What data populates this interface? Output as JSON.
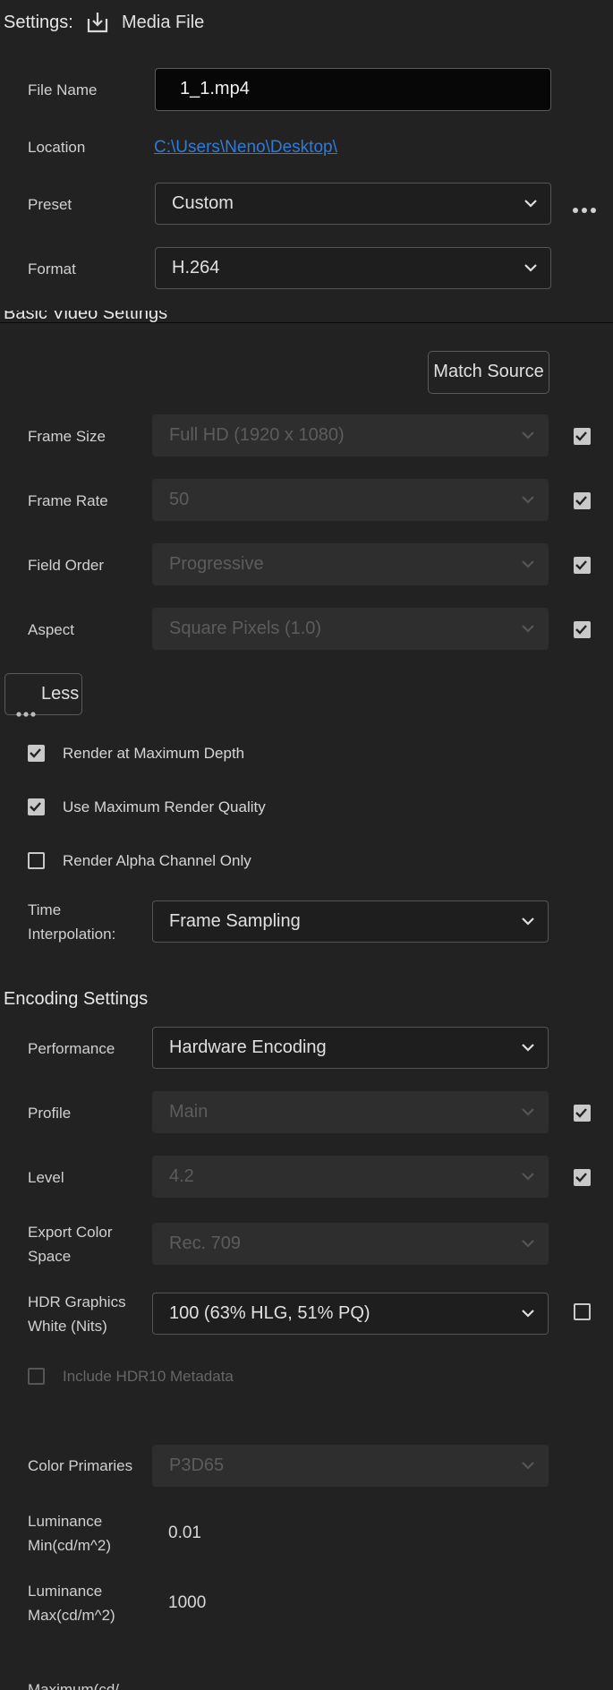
{
  "header": {
    "settings_label": "Settings:",
    "media_label": "Media File",
    "icon": "download-tray-icon"
  },
  "file": {
    "file_name_label": "File Name",
    "file_name_value": "1_1.mp4",
    "location_label": "Location",
    "location_value": "C:\\Users\\Neno\\Desktop\\",
    "preset_label": "Preset",
    "preset_value": "Custom",
    "more_icon": "more-dots-icon",
    "format_label": "Format",
    "format_value": "H.264"
  },
  "basic_video": {
    "section_title": "Basic Video Settings",
    "match_source_label": "Match Source",
    "frame_size_label": "Frame Size",
    "frame_size_value": "Full HD (1920 x 1080)",
    "frame_size_checked": true,
    "frame_rate_label": "Frame Rate",
    "frame_rate_value": "50",
    "frame_rate_checked": true,
    "field_order_label": "Field Order",
    "field_order_value": "Progressive",
    "field_order_checked": true,
    "aspect_label": "Aspect",
    "aspect_value": "Square Pixels (1.0)",
    "aspect_checked": true,
    "less_label": "Less",
    "less_icon": "more-dots-icon",
    "render_max_depth_label": "Render at Maximum Depth",
    "render_max_depth_checked": true,
    "max_render_quality_label": "Use Maximum Render Quality",
    "max_render_quality_checked": true,
    "render_alpha_label": "Render Alpha Channel Only",
    "render_alpha_checked": false,
    "time_interp_label_line1": "Time",
    "time_interp_label_line2": "Interpolation:",
    "time_interp_value": "Frame Sampling"
  },
  "encoding": {
    "section_title": "Encoding Settings",
    "performance_label": "Performance",
    "performance_value": "Hardware Encoding",
    "profile_label": "Profile",
    "profile_value": "Main",
    "profile_checked": true,
    "level_label": "Level",
    "level_value": "4.2",
    "level_checked": true,
    "export_color_label_line1": "Export Color",
    "export_color_label_line2": "Space",
    "export_color_value": "Rec. 709",
    "hdr_white_label_line1": "HDR Graphics",
    "hdr_white_label_line2": "White (Nits)",
    "hdr_white_value": "100 (63% HLG, 51% PQ)",
    "hdr_white_checked": false,
    "include_hdr10_label": "Include HDR10 Metadata",
    "include_hdr10_checked": false,
    "color_primaries_label": "Color Primaries",
    "color_primaries_value": "P3D65",
    "lum_min_label_line1": "Luminance",
    "lum_min_label_line2": "Min(cd/m^2)",
    "lum_min_value": "0.01",
    "lum_max_label_line1": "Luminance",
    "lum_max_label_line2": "Max(cd/m^2)",
    "lum_max_value": "1000",
    "cut_label": "Maximum(cd/"
  },
  "colors": {
    "background": "#222222",
    "link": "#2f7bd8",
    "text": "#d4d4d4"
  }
}
